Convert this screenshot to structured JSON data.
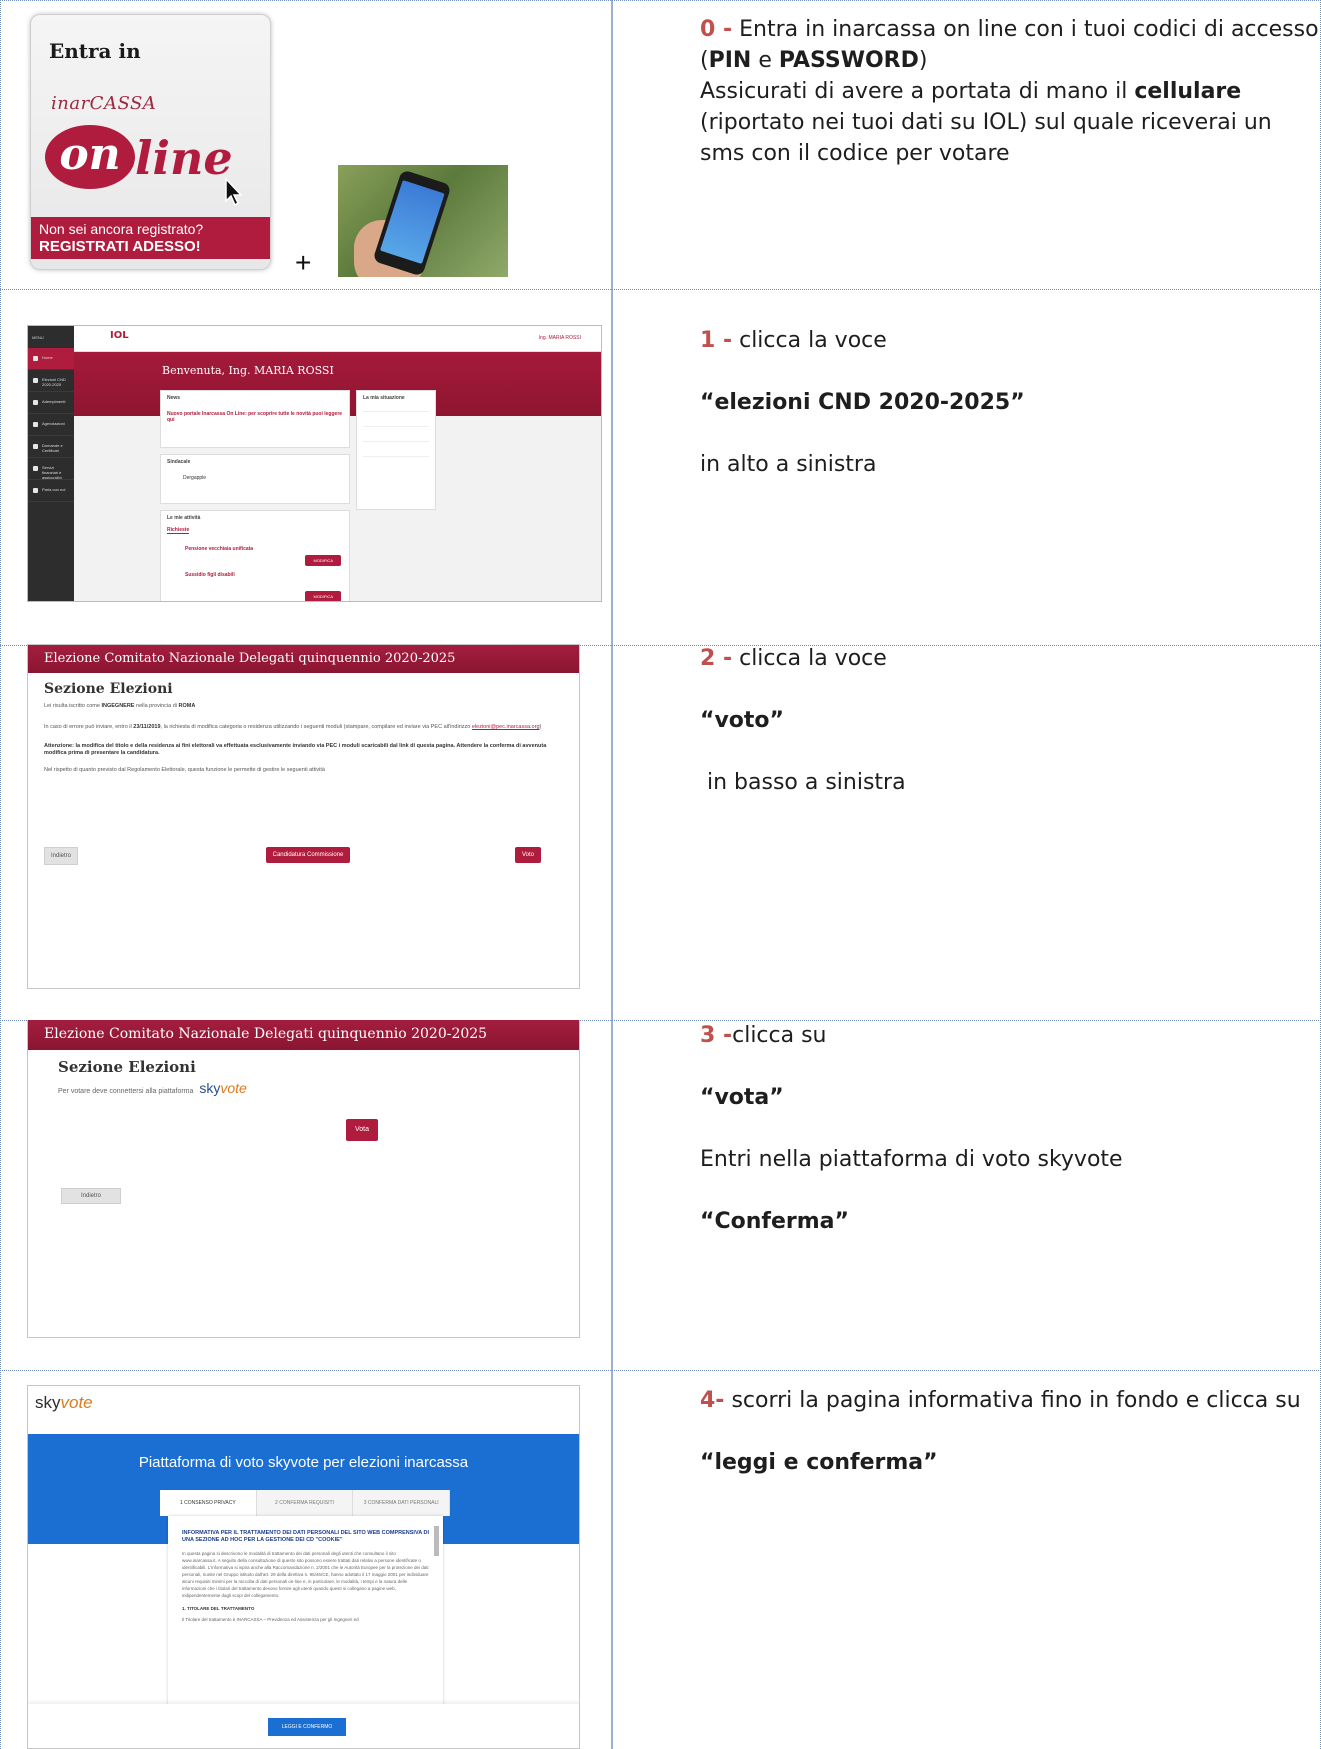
{
  "row0": {
    "card": {
      "entra": "Entra in",
      "brand": "inarCASSA",
      "on": "on",
      "line": "line",
      "reg_line1": "Non sei ancora registrato?",
      "reg_line2": "REGISTRATI ADESSO!"
    },
    "plus": "+",
    "step": {
      "num": "0 -",
      "t1": " Entra in inarcassa on line con i tuoi codici di accesso (",
      "pin": "PIN",
      "e": " e ",
      "password": "PASSWORD",
      "t2": ")",
      "t3": "Assicurati di avere a portata di mano il ",
      "cellulare": "cellulare",
      "t4": " (riportato nei tuoi dati su IOL) sul quale riceverai un sms con il codice per votare"
    }
  },
  "row1": {
    "dash": {
      "logo": "IOL",
      "user": "Ing. MARIA ROSSI",
      "welcome": "Benvenuta, Ing. MARIA ROSSI",
      "menu_header": "MENU",
      "menu": [
        "Home",
        "Elezioni CND 2020-2025",
        "Adempimenti",
        "Agevolazioni",
        "Domande e Certificati",
        "Servizi finanziari e assicurativi",
        "Parla con noi"
      ],
      "news_title": "News",
      "news_link": "Nuovo portale Inarcassa On Line: per scoprire tutte le novità puoi leggere qui",
      "sindacale_title": "Sindacale",
      "sindacale_item": "Dergapple",
      "attivita_title": "Le mie attività",
      "attivita_tab": "Richieste",
      "att1": "Pensione vecchiaia unificata",
      "att2": "Sussidio figli disabili",
      "modifica": "MODIFICA",
      "situazione_title": "La mia situazione"
    },
    "step": {
      "num": "1 -",
      "t1": " clicca la voce",
      "hl": "“elezioni CND 2020-2025”",
      "t2": "in alto a sinistra"
    }
  },
  "row2": {
    "shot": {
      "bar": "Elezione Comitato Nazionale Delegati quinquennio 2020-2025",
      "title": "Sezione Elezioni",
      "p1a": "Lei risulta iscritto come ",
      "p1b": "INGEGNERE",
      "p1c": " nella provincia di ",
      "p1d": "ROMA",
      "p2a": "In caso di errore può inviare, entro il ",
      "p2b": "23/11/2019",
      "p2c": ", la richiesta di modifica categoria o residenza utilizzando i seguenti moduli (stampare, compilare ed inviare via PEC all'indirizzo ",
      "p2link": "elezioni@pec.inarcassa.org",
      "p2d": ")",
      "p3": "Attenzione: la modifica del titolo e della residenza ai fini elettorali va effettuata esclusivamente inviando via PEC i moduli scaricabili dal link di questa pagina. Attendere la conferma di avvenuta modifica prima di presentare la candidatura.",
      "p4": "Nel rispetto di quanto previsto dal Regolamento Elettorale, questa funzione le permette di gestire le seguenti attività",
      "indietro": "Indietro",
      "candidatura": "Candidatura Commissione",
      "voto": "Voto"
    },
    "step": {
      "num": "2 -",
      "t1": " clicca la voce",
      "hl": "“voto”",
      "t2": " in basso a sinistra"
    }
  },
  "row3": {
    "shot": {
      "bar": "Elezione Comitato Nazionale Delegati quinquennio 2020-2025",
      "title": "Sezione Elezioni",
      "p1": "Per votare deve connettersi alla piattaforma",
      "sky_a": "sky",
      "sky_b": "vote",
      "vota": "Vota",
      "indietro": "Indietro"
    },
    "step": {
      "num": "3 -",
      "t1": "clicca su",
      "hl1": "“vota”",
      "t2": "Entri nella piattaforma di voto skyvote",
      "hl2": "“Conferma”"
    }
  },
  "row4": {
    "sky": {
      "logo_a": "sky",
      "logo_b": "vote",
      "title": "Piattaforma di voto skyvote per elezioni inarcassa",
      "tabs": [
        "1 CONSENSO PRIVACY",
        "2 CONFERMA REQUISITI",
        "3 CONFERMA DATI PERSONALI"
      ],
      "doc_title": "INFORMATIVA PER IL TRATTAMENTO DEI DATI PERSONALI DEL SITO WEB COMPRENSIVA DI UNA SEZIONE AD HOC PER LA GESTIONE DEI CD \"COOKIE\"",
      "doc_body": "In questa pagina si descrivono le modalità di trattamento dei dati personali degli utenti che consultano il sito www.inarcassa.it. A seguito della consultazione di questo sito possono essere trattati dati relativi a persone identificate o identificabili. L'informativa si ispira anche alla Raccomandazione n. 2/2001 che le Autorità Europee per la protezione dei dati personali, riunite nel Gruppo istituito dall'art. 29 della direttiva n. 95/46/CE, hanno adottato il 17 maggio 2001 per individuare alcuni requisiti minimi per la raccolta di dati personali on-line e, in particolare, le modalità, i tempi e la natura delle informazioni che i titolari del trattamento devono fornire agli utenti quando questi si collegano a pagine web, indipendentemente dagli scopi del collegamento.",
      "doc_section": "1. TITOLARE DEL TRATTAMENTO",
      "doc_section_body": "Il Titolare del trattamento è INARCASSA – Previdenza ed Assistenza per gli Ingegneri ed",
      "leggi": "LEGGI E CONFERMO"
    },
    "step": {
      "num": "4-",
      "t1": " scorri la pagina informativa fino in fondo e clicca su",
      "hl": "“leggi e conferma”"
    }
  },
  "colors": {
    "inarcassa_red": "#b01c3d",
    "step_number": "#c0504d",
    "skyvote_blue": "#1b6fd3",
    "grid_line": "#6f8fb8"
  }
}
